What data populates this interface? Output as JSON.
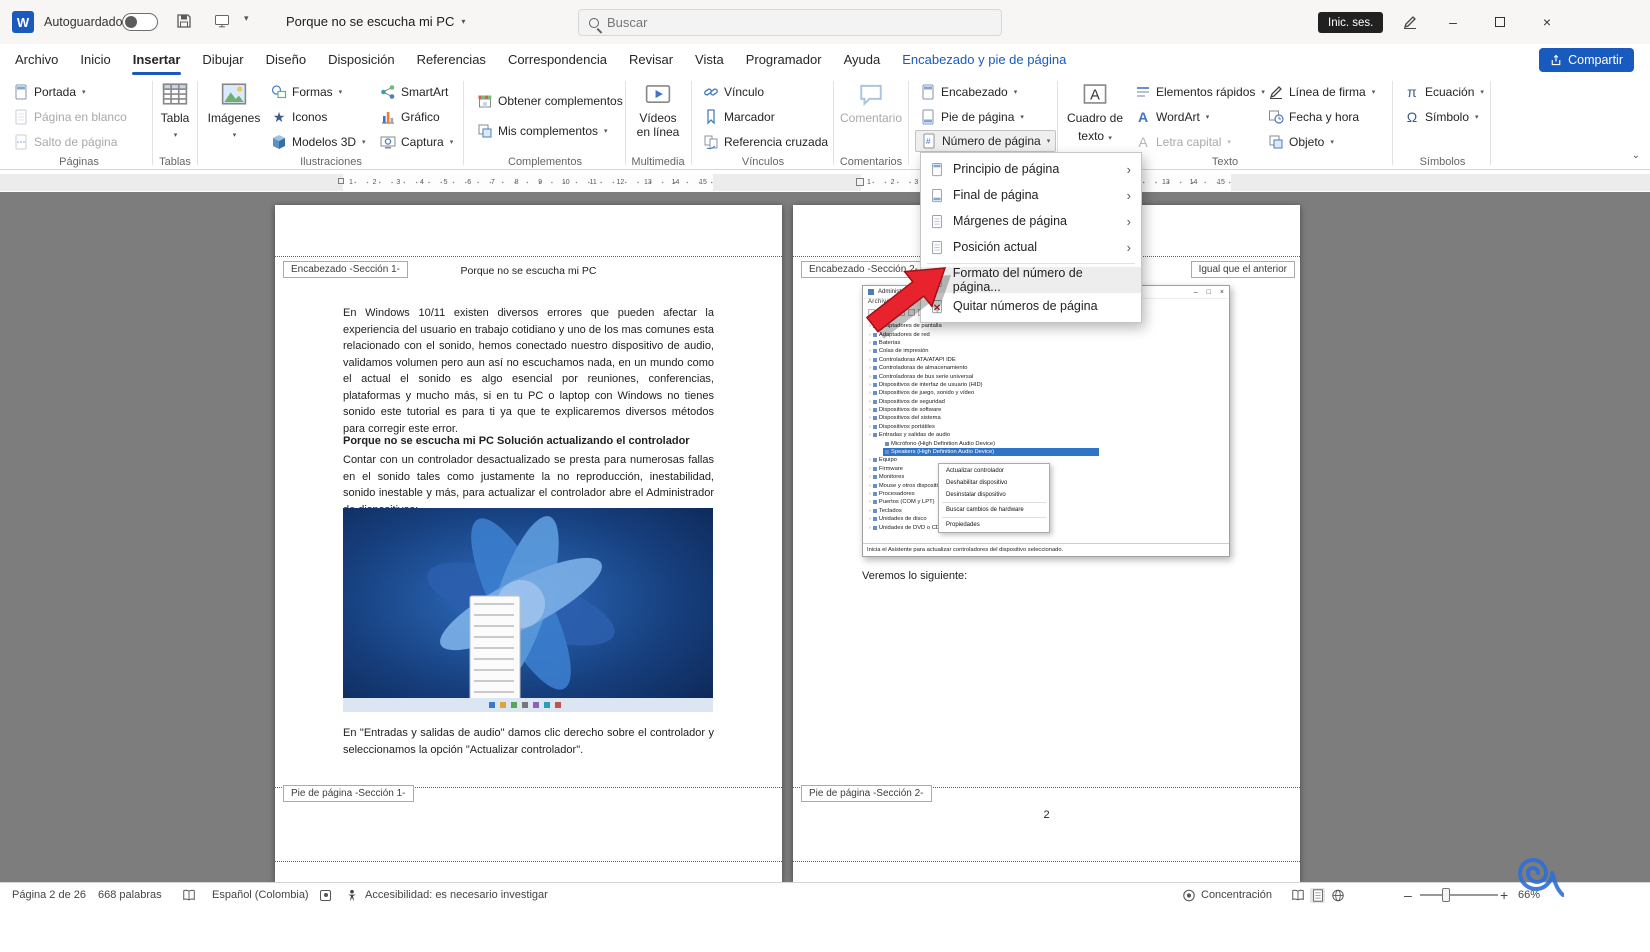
{
  "titlebar": {
    "autosave": "Autoguardado",
    "doc_title": "Porque no se escucha mi PC",
    "search_placeholder": "Buscar",
    "signin": "Inic. ses."
  },
  "tabs": {
    "items": [
      "Archivo",
      "Inicio",
      "Insertar",
      "Dibujar",
      "Diseño",
      "Disposición",
      "Referencias",
      "Correspondencia",
      "Revisar",
      "Vista",
      "Programador",
      "Ayuda"
    ],
    "contextual": "Encabezado y pie de página",
    "share": "Compartir"
  },
  "ribbon": {
    "paginas": {
      "label": "Páginas",
      "portada": "Portada",
      "blanco": "Página en blanco",
      "salto": "Salto de página"
    },
    "tablas": {
      "label": "Tablas",
      "tabla": "Tabla"
    },
    "ilustraciones": {
      "label": "Ilustraciones",
      "imagenes": "Imágenes",
      "formas": "Formas",
      "iconos": "Iconos",
      "modelos": "Modelos 3D",
      "smartart": "SmartArt",
      "grafico": "Gráfico",
      "captura": "Captura"
    },
    "complementos": {
      "label": "Complementos",
      "obtener": "Obtener complementos",
      "mis": "Mis complementos"
    },
    "multimedia": {
      "label": "Multimedia",
      "videos": "Vídeos en línea"
    },
    "vinculos": {
      "label": "Vínculos",
      "vinculo": "Vínculo",
      "marcador": "Marcador",
      "referencia": "Referencia cruzada"
    },
    "comentarios": {
      "label": "Comentarios",
      "comentario": "Comentario"
    },
    "encabezado_grp": {
      "encabezado": "Encabezado",
      "pie": "Pie de página",
      "numero": "Número de página"
    },
    "texto": {
      "label": "Texto",
      "cuadro1": "Cuadro de",
      "cuadro2": "texto",
      "elementos": "Elementos rápidos",
      "wordart": "WordArt",
      "letra": "Letra capital",
      "linea": "Línea de firma",
      "fecha": "Fecha y hora",
      "objeto": "Objeto"
    },
    "simbolos": {
      "label": "Símbolos",
      "ecuacion": "Ecuación",
      "simbolo": "Símbolo"
    }
  },
  "page_menu": {
    "items": [
      "Principio de página",
      "Final de página",
      "Márgenes de página",
      "Posición actual",
      "Formato del número de página...",
      "Quitar números de página"
    ]
  },
  "ruler": {
    "numbers": [
      "1",
      "2",
      "3",
      "4",
      "5",
      "6",
      "7",
      "8",
      "9",
      "10",
      "11",
      "12",
      "13",
      "14",
      "15"
    ]
  },
  "page1": {
    "header_tag": "Encabezado -Sección 1-",
    "header_text": "Porque no se escucha mi PC",
    "para1": "En Windows 10/11 existen diversos errores que pueden afectar la experiencia del usuario en trabajo cotidiano y uno de los mas comunes esta relacionado con el sonido, hemos conectado nuestro dispositivo de audio, validamos volumen pero aun así no escuchamos nada, en un mundo como el actual el sonido es algo esencial por reuniones, conferencias, plataformas y mucho más, si en tu PC o laptop con Windows no tienes sonido este tutorial es para ti ya que te explicaremos diversos métodos para corregir este error.",
    "heading": "Porque no se escucha mi PC Solución actualizando el controlador",
    "para2": "Contar con un controlador desactualizado se presta para numerosas fallas en el sonido tales como justamente la no reproducción, inestabilidad, sonido inestable y más, para actualizar el controlador abre el Administrador de dispositivos:",
    "para3": "En \"Entradas y salidas de audio\" damos clic derecho sobre el controlador y seleccionamos la opción \"Actualizar controlador\".",
    "footer_tag": "Pie de página -Sección 1-"
  },
  "page2": {
    "header_tag": "Encabezado -Sección 2-",
    "same_badge": "Igual que el anterior",
    "caption": "Veremos lo siguiente:",
    "footer_tag": "Pie de página -Sección 2-",
    "page_number": "2"
  },
  "device_manager": {
    "title": "Administrador de dispositivos",
    "menubar": "Archivo   Acción   Ver   Ayuda",
    "tree_a": [
      "Adaptadores de pantalla",
      "Adaptadores de red",
      "Baterías",
      "Colas de impresión",
      "Controladoras ATA/ATAPI IDE",
      "Controladoras de almacenamiento",
      "Controladoras de bus serie universal",
      "Dispositivos de interfaz de usuario (HID)",
      "Dispositivos de juego, sonido y vídeo",
      "Dispositivos de seguridad",
      "Dispositivos de software",
      "Dispositivos del sistema",
      "Dispositivos portátiles",
      "Entradas y salidas de audio"
    ],
    "tree_children": [
      "Micrófono (High Definition Audio Device)",
      "Speakers (High Definition Audio Device)"
    ],
    "tree_b": [
      "Equipo",
      "Firmware",
      "Monitores",
      "Mouse y otros dispositivos señaladores",
      "Procesadores",
      "Puertos (COM y LPT)",
      "Teclados",
      "Unidades de disco",
      "Unidades de DVD o CD-ROM"
    ],
    "context_menu": [
      "Actualizar controlador",
      "Deshabilitar dispositivo",
      "Desinstalar dispositivo",
      "Buscar cambios de hardware",
      "Propiedades"
    ],
    "status": "Inicia el Asistente para actualizar controladores del dispositivo seleccionado."
  },
  "statusbar": {
    "page_info": "Página 2 de 26",
    "words": "668 palabras",
    "language": "Español (Colombia)",
    "accessibility": "Accesibilidad: es necesario investigar",
    "focus": "Concentración",
    "zoom": "66%"
  }
}
